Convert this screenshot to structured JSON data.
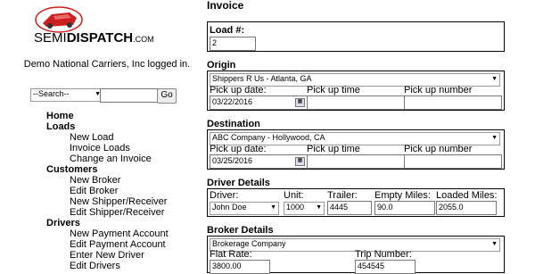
{
  "logo": {
    "semi": "SEMI",
    "dispatch": "DISPATCH",
    "com": ".COM"
  },
  "logged_in": "Demo National Carriers, Inc logged in.",
  "search": {
    "selected": "--Search--",
    "value": "",
    "go": "Go"
  },
  "nav": [
    {
      "label": "Home",
      "heading": true
    },
    {
      "label": "Loads",
      "heading": true
    },
    {
      "label": "New Load",
      "heading": false
    },
    {
      "label": "Invoice Loads",
      "heading": false
    },
    {
      "label": "Change an Invoice",
      "heading": false
    },
    {
      "label": "Customers",
      "heading": true
    },
    {
      "label": "New Broker",
      "heading": false
    },
    {
      "label": "Edit Broker",
      "heading": false
    },
    {
      "label": "New Shipper/Receiver",
      "heading": false
    },
    {
      "label": "Edit Shipper/Receiver",
      "heading": false
    },
    {
      "label": "Drivers",
      "heading": true
    },
    {
      "label": "New Payment Account",
      "heading": false
    },
    {
      "label": "Edit Payment Account",
      "heading": false
    },
    {
      "label": "Enter New Driver",
      "heading": false
    },
    {
      "label": "Edit Drivers",
      "heading": false
    }
  ],
  "page_title": "Invoice",
  "load": {
    "label": "Load #:",
    "value": "2"
  },
  "origin": {
    "title": "Origin",
    "selected": "Shippers R Us - Atlanta, GA",
    "pickup_date_label": "Pick up date:",
    "pickup_date": "03/22/2016",
    "pickup_time_label": "Pick up time",
    "pickup_time": "",
    "pickup_number_label": "Pick up number",
    "pickup_number": ""
  },
  "destination": {
    "title": "Destination",
    "selected": "ABC Company - Hollywood, CA",
    "pickup_date_label": "Pick up date:",
    "pickup_date": "03/25/2016",
    "pickup_time_label": "Pick up time",
    "pickup_time": "",
    "pickup_number_label": "Pick up number",
    "pickup_number": ""
  },
  "driver": {
    "title": "Driver Details",
    "driver_label": "Driver:",
    "driver_value": "John Doe",
    "unit_label": "Unit:",
    "unit_value": "1000",
    "trailer_label": "Trailer:",
    "trailer_value": "4445",
    "empty_label": "Empty Miles:",
    "empty_value": "90.0",
    "loaded_label": "Loaded Miles:",
    "loaded_value": "2055.0"
  },
  "broker": {
    "title": "Broker Details",
    "selected": "Brokerage Company",
    "flat_rate_label": "Flat Rate:",
    "flat_rate": "3800.00",
    "trip_label": "Trip Number:",
    "trip_number": "454545"
  },
  "colors": {
    "logo_red": "#cc1f1f",
    "border": "#000000"
  }
}
